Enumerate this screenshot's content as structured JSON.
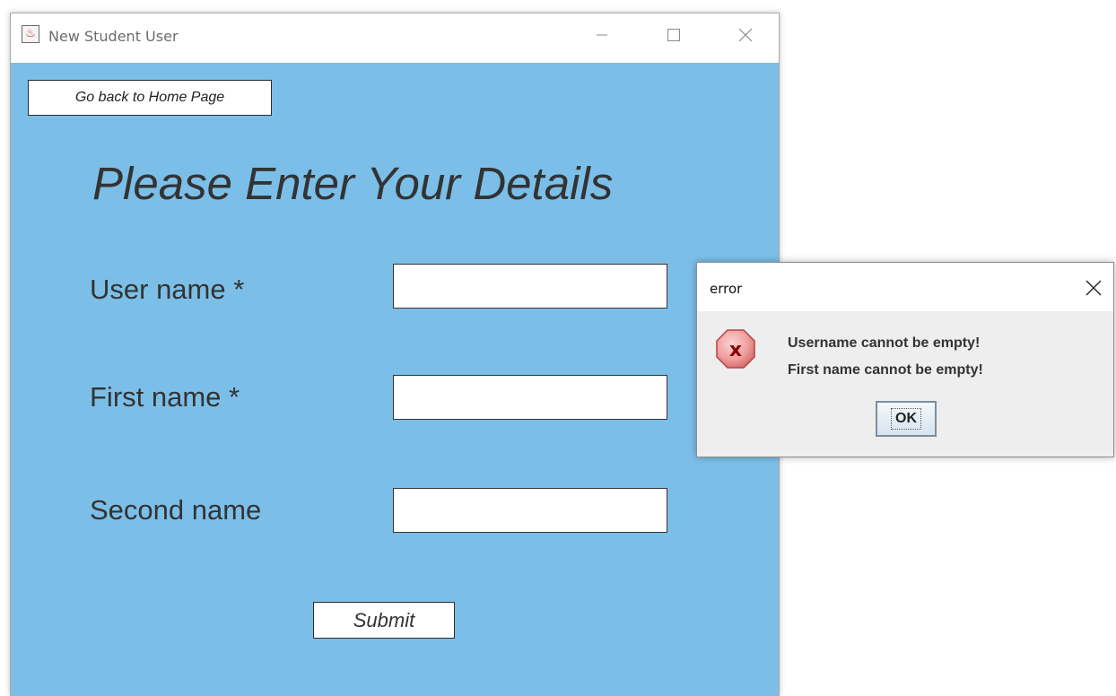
{
  "main_window": {
    "title": "New Student User",
    "icon": "java-app-icon",
    "controls": [
      "minimize-icon",
      "maximize-icon",
      "close-icon"
    ]
  },
  "form": {
    "home_button_label": "Go back to Home Page",
    "heading": "Please Enter Your Details",
    "fields": [
      {
        "label": "User name *",
        "value": ""
      },
      {
        "label": "First name *",
        "value": ""
      },
      {
        "label": "Second name",
        "value": ""
      }
    ],
    "submit_label": "Submit"
  },
  "error_dialog": {
    "title": "error",
    "icon": "error-x-icon",
    "messages": [
      "Username cannot be empty!",
      "First name cannot be empty!"
    ],
    "ok_label": "OK"
  },
  "colors": {
    "form_background": "#7bbfe8",
    "error_icon": "#d9534f"
  }
}
